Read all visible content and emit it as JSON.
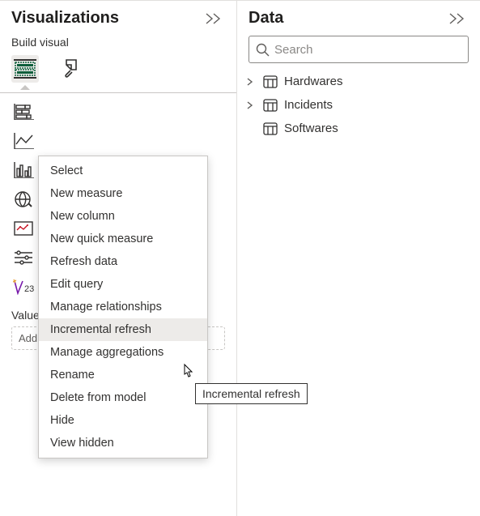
{
  "viz": {
    "title": "Visualizations",
    "section_label": "Build visual",
    "values_label": "Values",
    "field_well_placeholder": "Add data fields here"
  },
  "data": {
    "title": "Data",
    "search_placeholder": "Search",
    "tables": [
      {
        "name": "Hardwares"
      },
      {
        "name": "Incidents"
      },
      {
        "name": "Softwares"
      }
    ]
  },
  "context_menu": {
    "items": [
      "Select",
      "New measure",
      "New column",
      "New quick measure",
      "Refresh data",
      "Edit query",
      "Manage relationships",
      "Incremental refresh",
      "Manage aggregations",
      "Rename",
      "Delete from model",
      "Hide",
      "View hidden"
    ],
    "hovered_index": 7
  },
  "tooltip": {
    "text": "Incremental refresh"
  }
}
